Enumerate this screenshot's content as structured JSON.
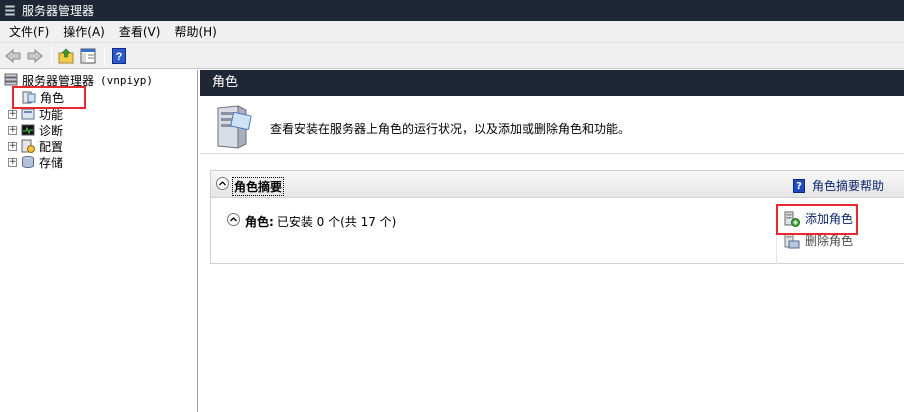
{
  "window": {
    "title": "服务器管理器"
  },
  "menubar": {
    "items": [
      "文件(F)",
      "操作(A)",
      "查看(V)",
      "帮助(H)"
    ]
  },
  "toolbar": {
    "back_icon": "back-arrow-icon",
    "forward_icon": "forward-arrow-icon",
    "up_icon": "up-folder-icon",
    "console_icon": "console-tree-icon",
    "help_icon": "help-icon"
  },
  "tree": {
    "root": {
      "label": "服务器管理器",
      "host": "(vnpiyp)"
    },
    "items": [
      {
        "label": "角色",
        "expander": ""
      },
      {
        "label": "功能",
        "expander": "+"
      },
      {
        "label": "诊断",
        "expander": "+"
      },
      {
        "label": "配置",
        "expander": "+"
      },
      {
        "label": "存储",
        "expander": "+"
      }
    ]
  },
  "main": {
    "header": "角色",
    "intro": "查看安装在服务器上角色的运行状况，以及添加或删除角色和功能。",
    "summary": {
      "title": "角色摘要",
      "help_link": "角色摘要帮助",
      "roles_label": "角色:",
      "roles_status": "已安装 0 个(共 17 个)",
      "actions": [
        {
          "label": "添加角色",
          "enabled": true
        },
        {
          "label": "删除角色",
          "enabled": false
        }
      ]
    }
  },
  "colors": {
    "titlebar_bg": "#1f2736",
    "highlight": "#e8272e",
    "link": "#0a246a"
  }
}
